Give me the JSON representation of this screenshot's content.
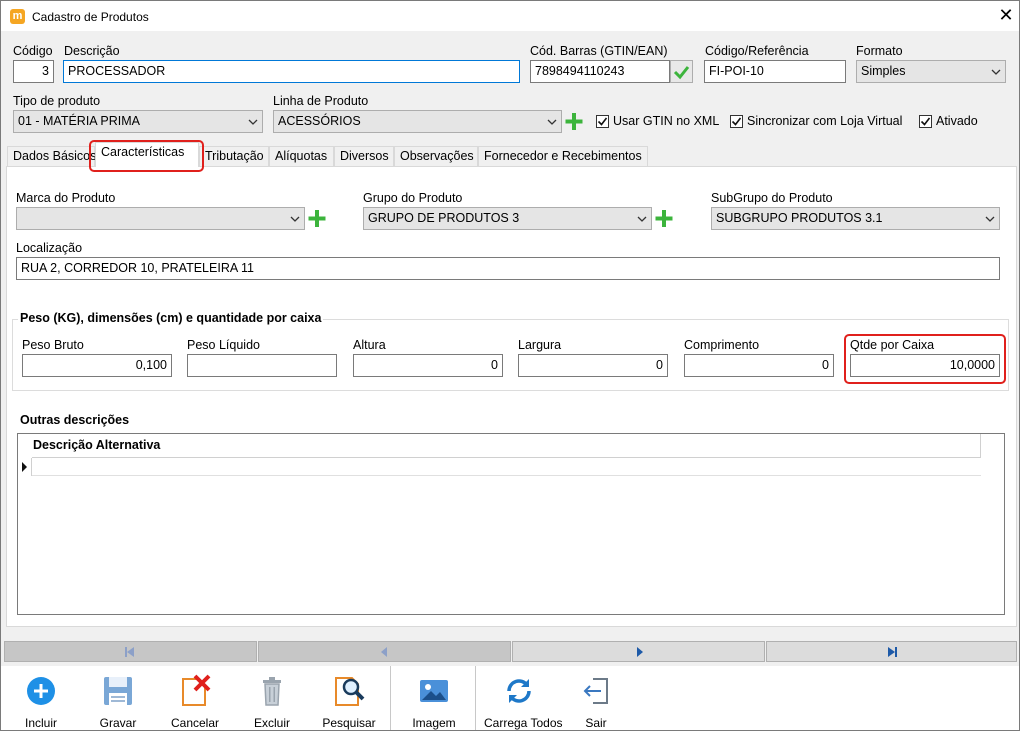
{
  "window": {
    "title": "Cadastro de Produtos",
    "app_icon_letter": "m"
  },
  "header": {
    "codigo_label": "Código",
    "codigo_value": "3",
    "descricao_label": "Descrição",
    "descricao_value": "PROCESSADOR",
    "barras_label": "Cód. Barras (GTIN/EAN)",
    "barras_value": "7898494110243",
    "referencia_label": "Código/Referência",
    "referencia_value": "FI-POI-10",
    "formato_label": "Formato",
    "formato_value": "Simples",
    "tipo_label": "Tipo de produto",
    "tipo_value": "01 - MATÉRIA PRIMA",
    "linha_label": "Linha de Produto",
    "linha_value": "ACESSÓRIOS",
    "chk_gtin_label": "Usar GTIN no XML",
    "chk_gtin_checked": true,
    "chk_loja_label": "Sincronizar com Loja Virtual",
    "chk_loja_checked": true,
    "chk_ativado_label": "Ativado",
    "chk_ativado_checked": true
  },
  "tabs": [
    {
      "label": "Dados Básicos",
      "active": false
    },
    {
      "label": "Características",
      "active": true
    },
    {
      "label": "Tributação",
      "active": false
    },
    {
      "label": "Alíquotas",
      "active": false
    },
    {
      "label": "Diversos",
      "active": false
    },
    {
      "label": "Observações",
      "active": false
    },
    {
      "label": "Fornecedor e Recebimentos",
      "active": false
    }
  ],
  "caracteristicas": {
    "marca_label": "Marca do Produto",
    "marca_value": "",
    "grupo_label": "Grupo do Produto",
    "grupo_value": "GRUPO DE PRODUTOS 3",
    "subgrupo_label": "SubGrupo do Produto",
    "subgrupo_value": "SUBGRUPO PRODUTOS 3.1",
    "localizacao_label": "Localização",
    "localizacao_value": "RUA 2, CORREDOR 10, PRATELEIRA 11",
    "peso_group_title": "Peso (KG), dimensões (cm) e quantidade por caixa",
    "peso_bruto_label": "Peso Bruto",
    "peso_bruto_value": "0,100",
    "peso_liquido_label": "Peso Líquido",
    "peso_liquido_value": "",
    "altura_label": "Altura",
    "altura_value": "0",
    "largura_label": "Largura",
    "largura_value": "0",
    "comprimento_label": "Comprimento",
    "comprimento_value": "0",
    "qtde_caixa_label": "Qtde por Caixa",
    "qtde_caixa_value": "10,0000",
    "outras_title": "Outras descrições",
    "grid_header": "Descrição Alternativa"
  },
  "toolbar": {
    "incluir": "Incluir",
    "gravar": "Gravar",
    "cancelar": "Cancelar",
    "excluir": "Excluir",
    "pesquisar": "Pesquisar",
    "imagem": "Imagem",
    "carrega_todos": "Carrega Todos",
    "sair": "Sair"
  },
  "colors": {
    "accent_red": "#e0201c",
    "plus_green": "#3cb43c",
    "incluir_blue": "#1e90e6"
  }
}
